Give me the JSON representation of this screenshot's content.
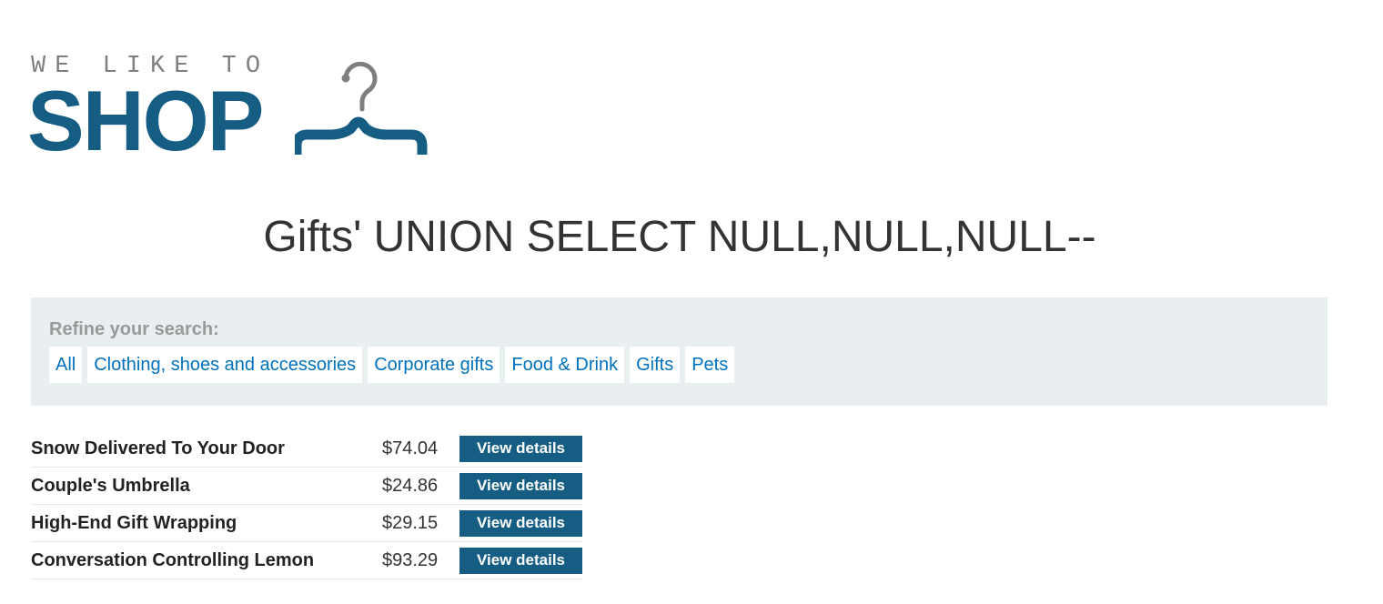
{
  "logo": {
    "tagline": "WE LIKE TO",
    "word": "SHOP",
    "icon": "hanger-icon"
  },
  "heading": "Gifts' UNION SELECT NULL,NULL,NULL--",
  "filters": {
    "label": "Refine your search:",
    "items": [
      {
        "label": "All"
      },
      {
        "label": "Clothing, shoes and accessories"
      },
      {
        "label": "Corporate gifts"
      },
      {
        "label": "Food & Drink"
      },
      {
        "label": "Gifts"
      },
      {
        "label": "Pets"
      }
    ]
  },
  "products": [
    {
      "name": "Snow Delivered To Your Door",
      "price": "$74.04",
      "action": "View details"
    },
    {
      "name": "Couple's Umbrella",
      "price": "$24.86",
      "action": "View details"
    },
    {
      "name": "High-End Gift Wrapping",
      "price": "$29.15",
      "action": "View details"
    },
    {
      "name": "Conversation Controlling Lemon",
      "price": "$93.29",
      "action": "View details"
    }
  ],
  "colors": {
    "brand": "#155d82",
    "link": "#0071bc",
    "panel": "#e9eef1",
    "tagline": "#7f7f7f"
  }
}
